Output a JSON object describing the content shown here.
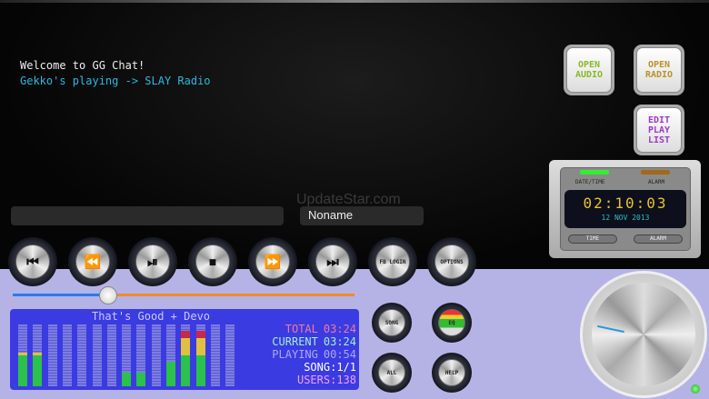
{
  "chat": {
    "lines": [
      "Welcome to GG Chat!",
      "Gekko's playing -> SLAY Radio"
    ]
  },
  "input": {
    "message_value": "",
    "name_value": "Noname"
  },
  "watermark": "UpdateStar.com",
  "transport": [
    {
      "name": "previous-track",
      "icon": "⏮"
    },
    {
      "name": "rewind",
      "icon": "⏪"
    },
    {
      "name": "play-pause",
      "icon": "⏯"
    },
    {
      "name": "stop",
      "icon": "⏹"
    },
    {
      "name": "fast-forward",
      "icon": "⏩"
    },
    {
      "name": "next-track",
      "icon": "⏭"
    }
  ],
  "buttons": {
    "fb_login": "FB LOGIN",
    "options": "OPTIONS",
    "song": "SONG",
    "eq": "EQ",
    "all": "ALL",
    "help": "HELP",
    "open_audio": "OPEN AUDIO",
    "open_radio": "OPEN RADIO",
    "edit_playlist": "EDIT PLAY LIST"
  },
  "progress": 0.28,
  "display": {
    "title": "That's Good + Devo",
    "eq_levels": [
      0.55,
      0.55,
      0,
      0,
      0,
      0,
      0,
      0.22,
      0.22,
      0,
      0.4,
      0.9,
      0.9,
      0,
      0
    ],
    "stats": [
      {
        "label": "TOTAL",
        "value": "03:24",
        "color": "#f07aa0"
      },
      {
        "label": "CURRENT",
        "value": "03:24",
        "color": "#a0f0d0"
      },
      {
        "label": "PLAYING",
        "value": "00:54",
        "color": "#a8a8f0"
      },
      {
        "label": "SONG",
        "value": ":1/1",
        "color": "#ffffff"
      },
      {
        "label": "USERS",
        "value": ":138",
        "color": "#f0a0f0"
      }
    ]
  },
  "clock": {
    "date_time_label": "DATE/TIME",
    "alarm_label": "ALARM",
    "time": "02:10:03",
    "date": "12 NOV 2013",
    "time_button": "TIME",
    "alarm_button": "ALARM"
  }
}
